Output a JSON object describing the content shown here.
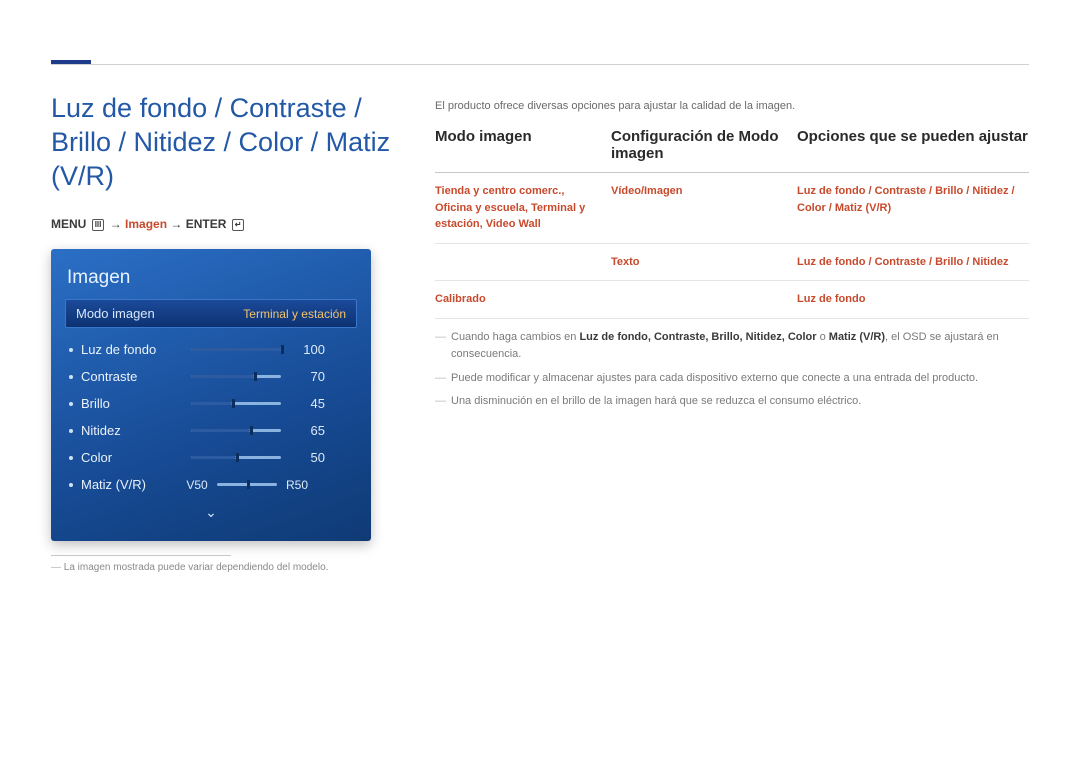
{
  "title": "Luz de fondo / Contraste / Brillo / Nitidez / Color / Matiz (V/R)",
  "menupath": {
    "menu": "MENU",
    "arrow1": " → ",
    "imagen": "Imagen",
    "arrow2": " → ",
    "enter": "ENTER"
  },
  "osd": {
    "title": "Imagen",
    "selected_label": "Modo imagen",
    "selected_value": "Terminal y estación",
    "sliders": [
      {
        "label": "Luz de fondo",
        "value": 100
      },
      {
        "label": "Contraste",
        "value": 70
      },
      {
        "label": "Brillo",
        "value": 45
      },
      {
        "label": "Nitidez",
        "value": 65
      },
      {
        "label": "Color",
        "value": 50
      }
    ],
    "tint": {
      "label": "Matiz (V/R)",
      "left": "V50",
      "right": "R50",
      "pos": 50
    }
  },
  "footnote": "La imagen mostrada puede variar dependiendo del modelo.",
  "intro": "El producto ofrece diversas opciones para ajustar la calidad de la imagen.",
  "table": {
    "headers": [
      "Modo imagen",
      "Configuración de Modo imagen",
      "Opciones que se pueden ajustar"
    ],
    "rows": [
      {
        "c1": "Tienda y centro comerc., Oficina y escuela, Terminal y estación, Video Wall",
        "c2": "Vídeo/Imagen",
        "c3": "Luz de fondo / Contraste / Brillo / Nitidez / Color / Matiz (V/R)"
      },
      {
        "c1": "",
        "c2": "Texto",
        "c3": "Luz de fondo / Contraste / Brillo / Nitidez"
      },
      {
        "c1": "Calibrado",
        "c2": "",
        "c3": "Luz de fondo"
      }
    ]
  },
  "notes": {
    "n1a": "Cuando haga cambios en ",
    "n1_terms": "Luz de fondo, Contraste, Brillo, Nitidez, Color",
    "n1_or": " o ",
    "n1_last": "Matiz (V/R)",
    "n1b": ", el OSD se ajustará en consecuencia.",
    "n2": "Puede modificar y almacenar ajustes para cada dispositivo externo que conecte a una entrada del producto.",
    "n3": "Una disminución en el brillo de la imagen hará que se reduzca el consumo eléctrico."
  }
}
